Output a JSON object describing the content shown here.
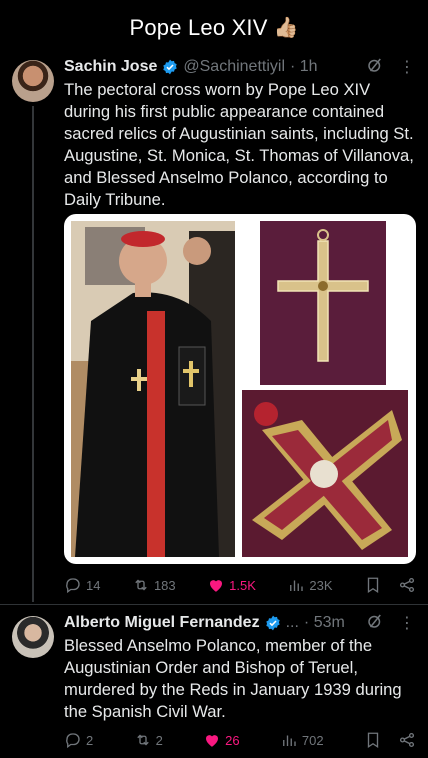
{
  "header": {
    "title": "Pope Leo XIV",
    "emoji": "👍🏼"
  },
  "post1": {
    "name": "Sachin Jose",
    "handle": "@Sachinettiyil",
    "time": "· 1h",
    "text": "The pectoral cross worn by Pope Leo XIV during his first public appearance contained sacred relics of Augustinian saints, including St. Augustine, St. Monica, St. Thomas of Villanova, and Blessed Anselmo Polanco, according to Daily Tribune.",
    "stats": {
      "replies": "14",
      "reposts": "183",
      "likes": "1.5K",
      "views": "23K"
    }
  },
  "post2": {
    "name": "Alberto Miguel Fernandez",
    "handle": "...",
    "time": "· 53m",
    "text": "Blessed Anselmo Polanco, member of the Augustinian Order and Bishop of Teruel, murdered by the Reds in January 1939 during the Spanish Civil War.",
    "stats": {
      "replies": "2",
      "reposts": "2",
      "likes": "26",
      "views": "702"
    }
  },
  "colors": {
    "background": "#000000",
    "muted": "#71767b",
    "like": "#f91880",
    "verified": "#1d9bf0"
  }
}
